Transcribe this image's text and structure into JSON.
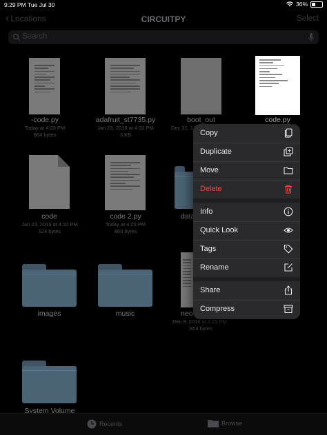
{
  "status": {
    "time": "9:29 PM",
    "date": "Tue Jul 30",
    "battery": "36%"
  },
  "nav": {
    "back": "Locations",
    "title": "CIRCUITPY",
    "select": "Select"
  },
  "search": {
    "placeholder": "Search"
  },
  "files": [
    {
      "name": "-code.py",
      "date": "Today at 4:23 PM",
      "size": "864 bytes"
    },
    {
      "name": "adafruit_st7735.py",
      "date": "Jan 23, 2019 at 4:32 PM",
      "size": "3 KB"
    },
    {
      "name": "boot_out",
      "date": "Dec 31, 1",
      "size": ""
    },
    {
      "name": "code.py",
      "date": "",
      "size": ""
    },
    {
      "name": "code",
      "date": "Jan 23, 2019 at 4:32 PM",
      "size": "524 bytes"
    },
    {
      "name": "code 2.py",
      "date": "Today at 4:23 PM",
      "size": "865 bytes"
    },
    {
      "name": "data",
      "date": "",
      "size": ""
    },
    {
      "name": "images",
      "date": "",
      "size": ""
    },
    {
      "name": "music",
      "date": "",
      "size": ""
    },
    {
      "name": "neo",
      "date": "Dec 8, 2018 at 2:25 PM",
      "size": "864 bytes"
    },
    {
      "name": "System Volume",
      "date": "",
      "size": ""
    }
  ],
  "menu": {
    "items": [
      {
        "label": "Copy",
        "icon": "copy-icon"
      },
      {
        "label": "Duplicate",
        "icon": "duplicate-icon"
      },
      {
        "label": "Move",
        "icon": "folder-icon"
      },
      {
        "label": "Delete",
        "icon": "trash-icon"
      },
      {
        "label": "Info",
        "icon": "info-icon"
      },
      {
        "label": "Quick Look",
        "icon": "eye-icon"
      },
      {
        "label": "Tags",
        "icon": "tag-icon"
      },
      {
        "label": "Rename",
        "icon": "pencil-icon"
      },
      {
        "label": "Share",
        "icon": "share-icon"
      },
      {
        "label": "Compress",
        "icon": "archive-icon"
      }
    ],
    "danger_color": "#ff453a"
  },
  "tabbar": {
    "recents": "Recents",
    "browse": "Browse"
  }
}
